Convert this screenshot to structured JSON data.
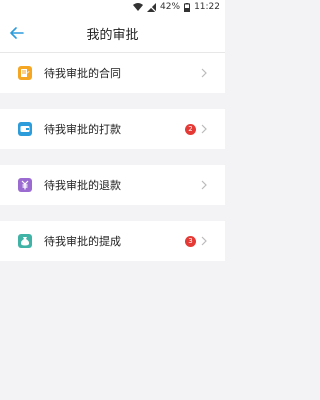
{
  "status_bar": {
    "battery": "42%",
    "time": "11:22"
  },
  "header": {
    "title": "我的审批"
  },
  "items": [
    {
      "label": "待我审批的合同",
      "icon": "contract-icon",
      "color": "#f5a623",
      "badge": ""
    },
    {
      "label": "待我审批的打款",
      "icon": "wallet-icon",
      "color": "#2d9cdb",
      "badge": "2"
    },
    {
      "label": "待我审批的退款",
      "icon": "refund-icon",
      "color": "#9b6bd1",
      "badge": ""
    },
    {
      "label": "待我审批的提成",
      "icon": "money-bag-icon",
      "color": "#40b3a6",
      "badge": "3"
    }
  ],
  "colors": {
    "accent": "#2d9cdb",
    "badge": "#e53935"
  }
}
